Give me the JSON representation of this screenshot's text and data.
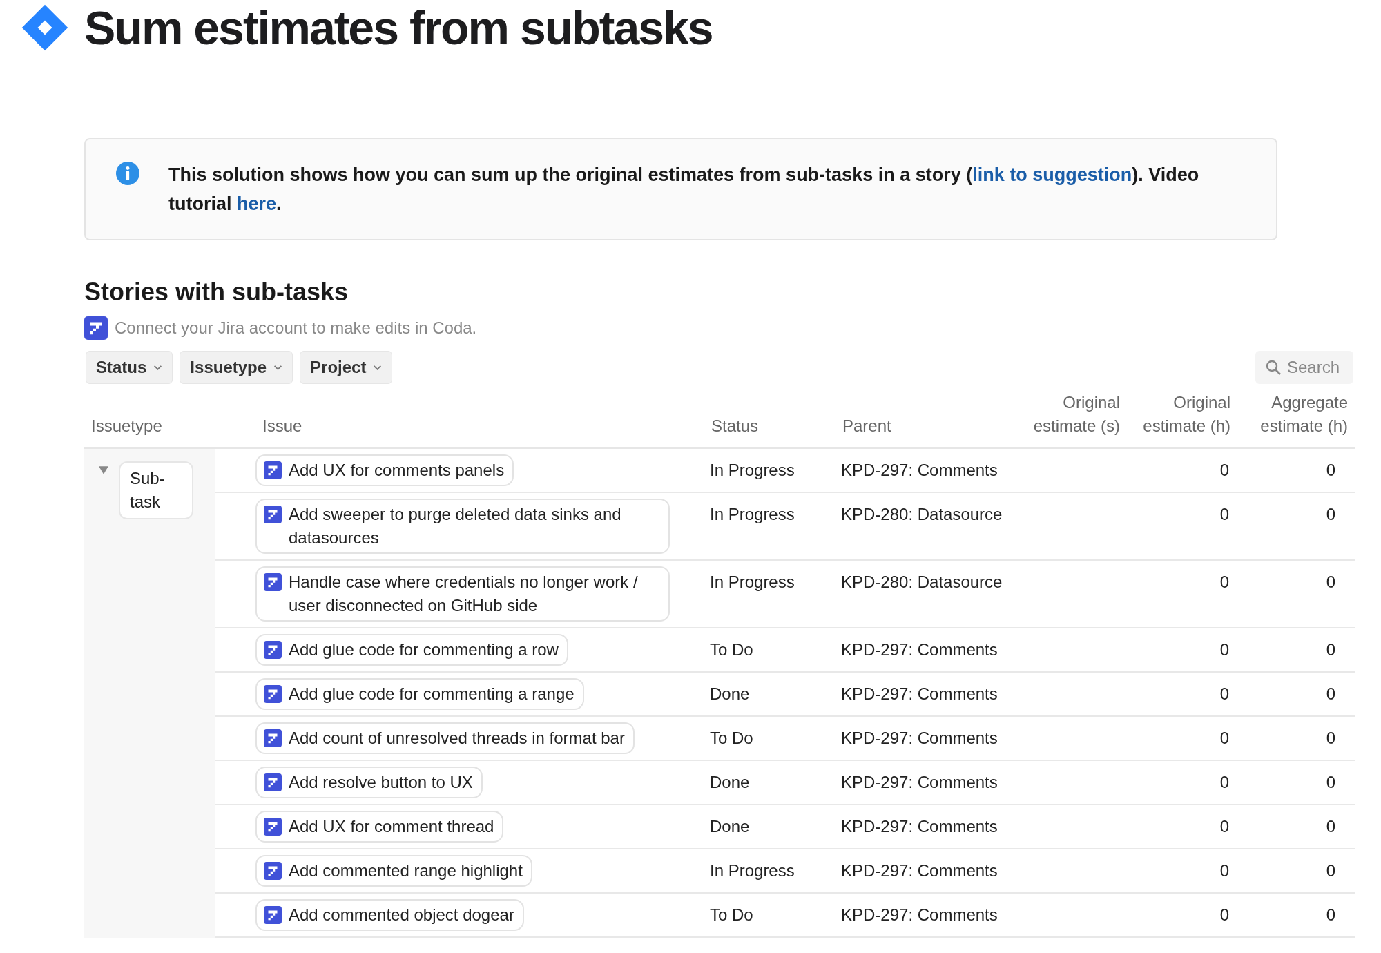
{
  "page": {
    "title": "Sum estimates from subtasks"
  },
  "info": {
    "parts": [
      {
        "kind": "text",
        "text": "This solution shows how you can sum up the original estimates from sub-tasks in a story ("
      },
      {
        "kind": "link",
        "text": "link to suggestion"
      },
      {
        "kind": "text",
        "text": "). Video tutorial "
      },
      {
        "kind": "link",
        "text": "here"
      },
      {
        "kind": "text",
        "text": "."
      }
    ]
  },
  "section": {
    "heading": "Stories with sub-tasks",
    "connect_note": "Connect your Jira account to make edits in Coda."
  },
  "filters": [
    "Status",
    "Issuetype",
    "Project"
  ],
  "search": {
    "placeholder": "Search"
  },
  "table": {
    "columns": [
      {
        "label": "Issuetype"
      },
      {
        "label": "Issue"
      },
      {
        "label": "Status"
      },
      {
        "label": "Parent"
      },
      {
        "label": "Original estimate (s)"
      },
      {
        "label": "Original estimate (h)"
      },
      {
        "label": "Aggregate estimate (h)"
      }
    ],
    "groups": [
      {
        "label": "Sub-task",
        "expanded": true,
        "rows": [
          {
            "issue": "Add UX for comments panels",
            "status": "In Progress",
            "parent": "KPD-297: Comments",
            "orig_h": "0",
            "aggregate_h": "0"
          },
          {
            "issue": "Add sweeper to purge deleted data sinks and datasources",
            "status": "In Progress",
            "parent": "KPD-280: Datasource",
            "orig_h": "0",
            "aggregate_h": "0"
          },
          {
            "issue": "Handle case where credentials no longer work / user disconnected on GitHub side",
            "status": "In Progress",
            "parent": "KPD-280: Datasource",
            "orig_h": "0",
            "aggregate_h": "0"
          },
          {
            "issue": "Add glue code for commenting a row",
            "status": "To Do",
            "parent": "KPD-297: Comments",
            "orig_h": "0",
            "aggregate_h": "0"
          },
          {
            "issue": "Add glue code for commenting a range",
            "status": "Done",
            "parent": "KPD-297: Comments",
            "orig_h": "0",
            "aggregate_h": "0"
          },
          {
            "issue": "Add count of unresolved threads in format bar",
            "status": "To Do",
            "parent": "KPD-297: Comments",
            "orig_h": "0",
            "aggregate_h": "0"
          },
          {
            "issue": "Add resolve button to UX",
            "status": "Done",
            "parent": "KPD-297: Comments",
            "orig_h": "0",
            "aggregate_h": "0"
          },
          {
            "issue": "Add UX for comment thread",
            "status": "Done",
            "parent": "KPD-297: Comments",
            "orig_h": "0",
            "aggregate_h": "0"
          },
          {
            "issue": "Add commented range highlight",
            "status": "In Progress",
            "parent": "KPD-297: Comments",
            "orig_h": "0",
            "aggregate_h": "0"
          },
          {
            "issue": "Add commented object dogear",
            "status": "To Do",
            "parent": "KPD-297: Comments",
            "orig_h": "0",
            "aggregate_h": "0"
          }
        ]
      }
    ]
  }
}
